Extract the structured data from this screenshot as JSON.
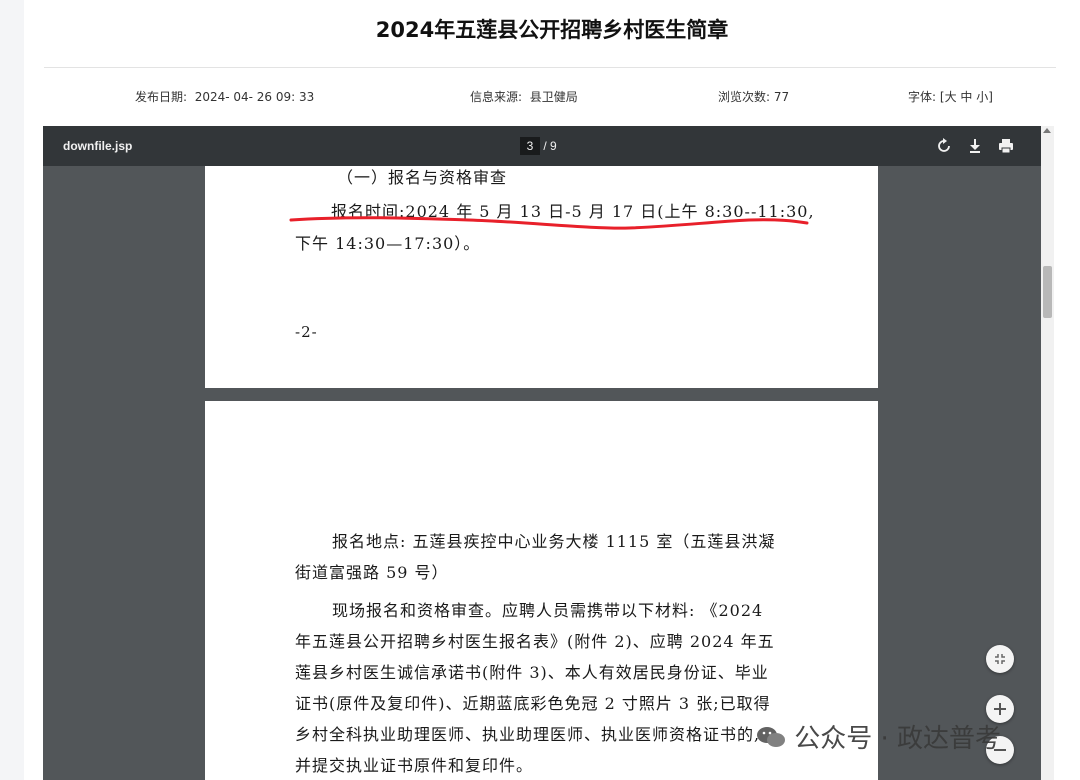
{
  "article": {
    "title": "2024年五莲县公开招聘乡村医生简章",
    "publish_label": "发布日期:",
    "publish_value": "2024- 04- 26 09: 33",
    "source_label": "信息来源:",
    "source_value": "县卫健局",
    "views_label": "浏览次数:",
    "views_value": "77",
    "font_label": "字体:",
    "font_open": "[",
    "font_large": "大",
    "font_medium": "中",
    "font_small": "小",
    "font_close": "]"
  },
  "viewer": {
    "filename": "downfile.jsp",
    "page_current": "3",
    "page_separator": "/",
    "page_total": "9",
    "icons": [
      "rotate-icon",
      "download-icon",
      "print-icon"
    ]
  },
  "document": {
    "page1": {
      "heading": "（一）报名与资格审查",
      "time_line1": "报名时间:2024 年 5 月 13 日-5 月 17 日(上午 8:30--11:30,",
      "time_line2": "下午 14:30—17:30）。",
      "page_number": "-2-"
    },
    "page2": {
      "lines": [
        "报名地点: 五莲县疾控中心业务大楼 1115 室（五莲县洪凝",
        "街道富强路 59 号）",
        "现场报名和资格审查。应聘人员需携带以下材料: 《2024",
        "年五莲县公开招聘乡村医生报名表》(附件 2)、应聘 2024 年五",
        "莲县乡村医生诚信承诺书(附件 3)、本人有效居民身份证、毕业",
        "证书(原件及复印件)、近期蓝底彩色免冠 2 寸照片 3 张;已取得",
        "乡村全科执业助理医师、执业助理医师、执业医师资格证书的,",
        "并提交执业证书原件和复印件。"
      ]
    }
  },
  "controls": {
    "fit_icon": "collapse-icon",
    "zoom_in_icon": "plus-icon",
    "zoom_out_icon": "minus-icon"
  },
  "watermark": {
    "text": "公众号 · 政达普考"
  },
  "colors": {
    "toolbar_bg": "#323639",
    "viewer_bg": "#525659",
    "annotation_red": "#e8202a"
  }
}
